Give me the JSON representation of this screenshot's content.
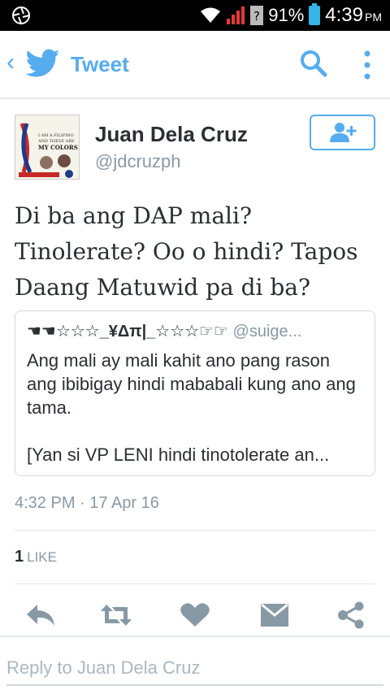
{
  "status_bar": {
    "battery": "91%",
    "time": "4:39",
    "ampm": "PM",
    "icons": [
      "aperture-icon",
      "wifi-icon",
      "signal-icon",
      "unknown-sim-icon",
      "battery-icon"
    ]
  },
  "app_bar": {
    "back_symbol": "‹",
    "title": "Tweet",
    "icons": [
      "twitter-bird-icon",
      "search-icon",
      "more-vert-icon"
    ]
  },
  "tweet": {
    "name": "Juan Dela Cruz",
    "handle": "@jdcruzph",
    "avatar_lines": [
      "I AM A FILIPINO",
      "AND THESE ARE",
      "MY COLORS"
    ],
    "text": "Di ba ang DAP mali? Tinolerate? Oo o hindi? Tapos Daang Matuwid pa di ba?",
    "timestamp": "4:32 PM · 17 Apr 16",
    "like_count": "1",
    "like_label": "LIKE"
  },
  "quoted": {
    "name": "☚☚☆☆☆_¥Δπ|_☆☆☆☞☞",
    "handle": "@suige...",
    "body": "Ang mali ay mali kahit ano pang rason ang ibibigay hindi mababali kung ano ang tama.",
    "body2": "[Yan si VP LENI hindi tinotolerate an..."
  },
  "actions": [
    "reply-icon",
    "retweet-icon",
    "like-heart-icon",
    "direct-message-icon",
    "share-icon"
  ],
  "reply_box": {
    "placeholder": "Reply to Juan Dela Cruz"
  },
  "colors": {
    "accent": "#55acee",
    "text": "#292f33",
    "muted": "#8899a6",
    "action_gray": "#8899a6"
  }
}
